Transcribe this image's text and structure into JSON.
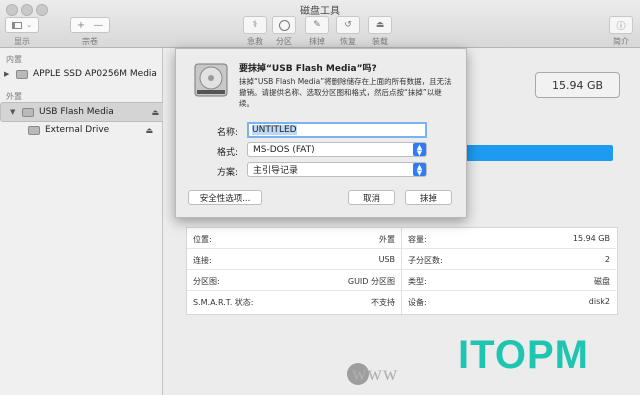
{
  "window": {
    "title": "磁盘工具"
  },
  "toolbar": {
    "view_label": "显示",
    "volume_label": "宗卷",
    "tools": [
      {
        "label": "急救",
        "icon": "stethoscope-icon"
      },
      {
        "label": "分区",
        "icon": "pie-icon"
      },
      {
        "label": "抹掉",
        "icon": "erase-icon"
      },
      {
        "label": "恢复",
        "icon": "restore-icon"
      },
      {
        "label": "装载",
        "icon": "mount-icon"
      }
    ],
    "info_label": "简介",
    "plus": "+",
    "minus": "—"
  },
  "sidebar": {
    "internal_label": "内置",
    "external_label": "外置",
    "items": [
      {
        "label": "APPLE SSD AP0256M Media"
      },
      {
        "label": "USB Flash Media"
      },
      {
        "label": "External Drive"
      }
    ]
  },
  "capacity_badge": "15.94 GB",
  "dialog": {
    "title": "要抹掉“USB Flash Media”吗?",
    "description": "抹掉“USB Flash Media”将删除储存在上面的所有数据，且无法撤销。请提供名称、选取分区图和格式，然后点按“抹掉”以继续。",
    "name_label": "名称:",
    "name_value": "UNTITLED",
    "format_label": "格式:",
    "format_value": "MS-DOS (FAT)",
    "scheme_label": "方案:",
    "scheme_value": "主引导记录",
    "security_button": "安全性选项...",
    "cancel_button": "取消",
    "erase_button": "抹掉"
  },
  "info": {
    "left": [
      {
        "k": "位置:",
        "v": "外置"
      },
      {
        "k": "连接:",
        "v": "USB"
      },
      {
        "k": "分区图:",
        "v": "GUID 分区图"
      },
      {
        "k": "S.M.A.R.T. 状态:",
        "v": "不支持"
      }
    ],
    "right": [
      {
        "k": "容量:",
        "v": "15.94 GB"
      },
      {
        "k": "子分区数:",
        "v": "2"
      },
      {
        "k": "类型:",
        "v": "磁盘"
      },
      {
        "k": "设备:",
        "v": "disk2"
      }
    ]
  },
  "watermark": {
    "brand": "ITOPM",
    "url": "www"
  }
}
